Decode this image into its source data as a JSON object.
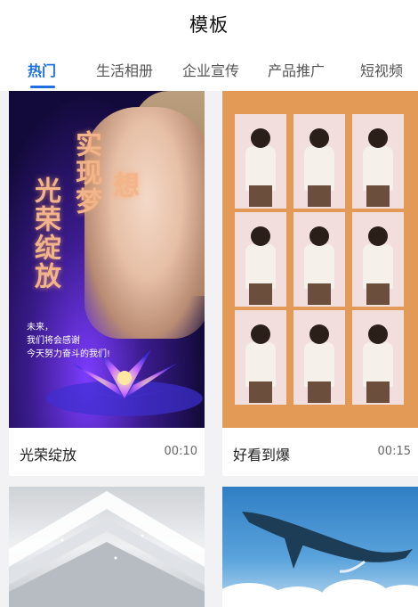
{
  "header": {
    "title": "模板"
  },
  "tabs": [
    {
      "label": "热门",
      "active": true
    },
    {
      "label": "生活相册",
      "active": false
    },
    {
      "label": "企业宣传",
      "active": false
    },
    {
      "label": "产品推广",
      "active": false
    },
    {
      "label": "短视频",
      "active": false
    }
  ],
  "colors": {
    "accent": "#1f6fe0",
    "background": "#f2f2f4"
  },
  "templates": [
    {
      "name": "光荣绽放",
      "duration": "00:10",
      "overlay": {
        "col1": "光荣绽放",
        "col2": "实现梦",
        "col3": "想",
        "lines": [
          "未来，",
          "我们将会感谢",
          "今天努力奋斗的我们!"
        ]
      }
    },
    {
      "name": "好看到爆",
      "duration": "00:15"
    },
    {
      "name": "",
      "duration": ""
    },
    {
      "name": "",
      "duration": ""
    }
  ]
}
